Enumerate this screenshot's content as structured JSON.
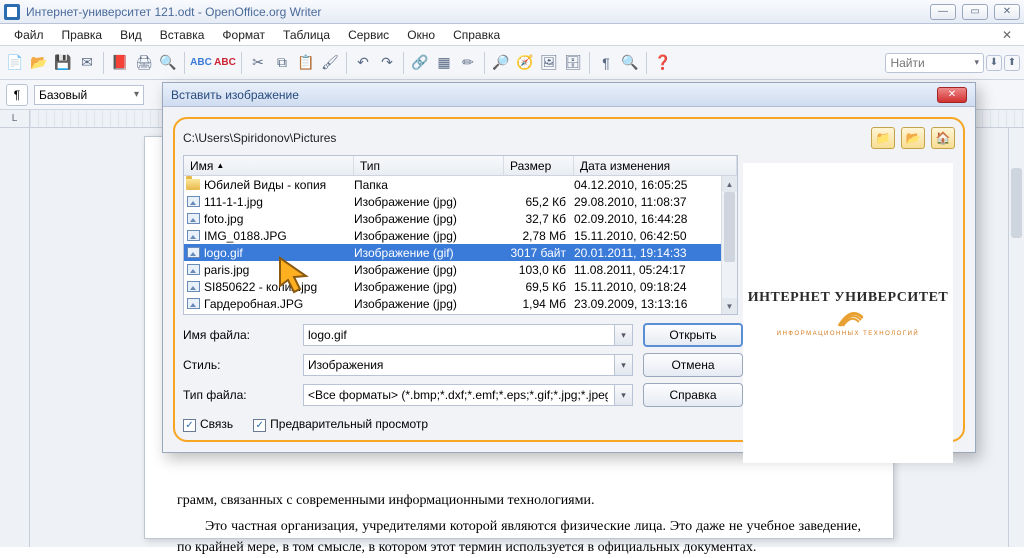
{
  "window": {
    "title": "Интернет-университет 121.odt - OpenOffice.org Writer"
  },
  "menubar": [
    "Файл",
    "Правка",
    "Вид",
    "Вставка",
    "Формат",
    "Таблица",
    "Сервис",
    "Окно",
    "Справка"
  ],
  "find": {
    "placeholder": "Найти"
  },
  "style": {
    "value": "Базовый"
  },
  "ruler_corner": "L",
  "document": {
    "p1": "грамм, связанных с современными информационными технологиями.",
    "p2": "Это частная организация, учредителями которой являются физические лица. Это даже не учебное заведение, по крайней мере, в том смысле, в котором этот термин используется в официальных документах."
  },
  "dialog": {
    "title": "Вставить изображение",
    "path": "C:\\Users\\Spiridonov\\Pictures",
    "columns": {
      "name": "Имя",
      "type": "Тип",
      "size": "Размер",
      "date": "Дата изменения"
    },
    "rows": [
      {
        "icon": "folder",
        "name": "Юбилей Виды - копия",
        "type": "Папка",
        "size": "",
        "date": "04.12.2010, 16:05:25",
        "sel": false
      },
      {
        "icon": "img",
        "name": "111-1-1.jpg",
        "type": "Изображение (jpg)",
        "size": "65,2 Кб",
        "date": "29.08.2010, 11:08:37",
        "sel": false
      },
      {
        "icon": "img",
        "name": "foto.jpg",
        "type": "Изображение (jpg)",
        "size": "32,7 Кб",
        "date": "02.09.2010, 16:44:28",
        "sel": false
      },
      {
        "icon": "img",
        "name": "IMG_0188.JPG",
        "type": "Изображение (jpg)",
        "size": "2,78 Мб",
        "date": "15.11.2010, 06:42:50",
        "sel": false
      },
      {
        "icon": "img",
        "name": "logo.gif",
        "type": "Изображение (gif)",
        "size": "3017 байт",
        "date": "20.01.2011, 19:14:33",
        "sel": true
      },
      {
        "icon": "img",
        "name": "paris.jpg",
        "type": "Изображение (jpg)",
        "size": "103,0 Кб",
        "date": "11.08.2011, 05:24:17",
        "sel": false
      },
      {
        "icon": "img",
        "name": "SI850622 - копия.jpg",
        "type": "Изображение (jpg)",
        "size": "69,5 Кб",
        "date": "15.11.2010, 09:18:24",
        "sel": false
      },
      {
        "icon": "img",
        "name": "Гардеробная.JPG",
        "type": "Изображение (jpg)",
        "size": "1,94 Мб",
        "date": "23.09.2009, 13:13:16",
        "sel": false
      }
    ],
    "labels": {
      "filename": "Имя файла:",
      "style": "Стиль:",
      "filetype": "Тип файла:"
    },
    "values": {
      "filename": "logo.gif",
      "style": "Изображения",
      "filetype": "<Все форматы> (*.bmp;*.dxf;*.emf;*.eps;*.gif;*.jpg;*.jpeg;*"
    },
    "buttons": {
      "open": "Открыть",
      "cancel": "Отмена",
      "help": "Справка"
    },
    "checks": {
      "link": "Связь",
      "preview": "Предварительный просмотр"
    },
    "preview": {
      "line1": "ИНТЕРНЕТ УНИВЕРСИТЕТ",
      "line2": "ИНФОРМАЦИОННЫХ ТЕХНОЛОГИЙ"
    }
  }
}
